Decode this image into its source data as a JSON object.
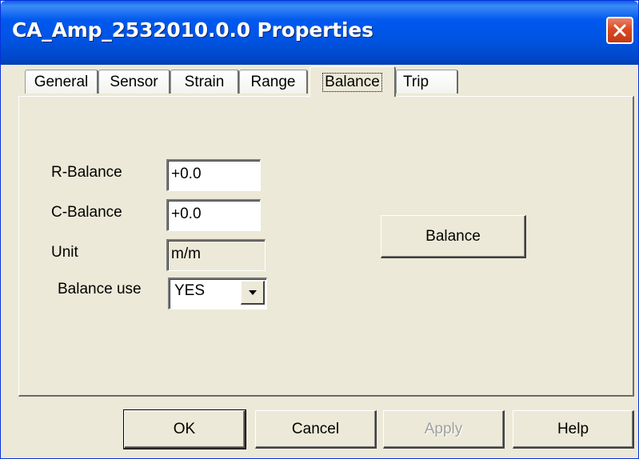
{
  "window": {
    "title": "CA_Amp_2532010.0.0 Properties"
  },
  "tabs": [
    {
      "label": "General"
    },
    {
      "label": "Sensor"
    },
    {
      "label": "Strain"
    },
    {
      "label": "Range"
    },
    {
      "label": "Balance",
      "active": true
    },
    {
      "label": "Trip"
    }
  ],
  "balance_tab": {
    "r_balance_label": "R-Balance",
    "r_balance_value": "+0.0",
    "c_balance_label": "C-Balance",
    "c_balance_value": "+0.0",
    "unit_label": "Unit",
    "unit_value": "m/m",
    "balance_use_label": "Balance use",
    "balance_use_value": "YES",
    "balance_button": "Balance"
  },
  "buttons": {
    "ok": "OK",
    "cancel": "Cancel",
    "apply": "Apply",
    "help": "Help"
  }
}
